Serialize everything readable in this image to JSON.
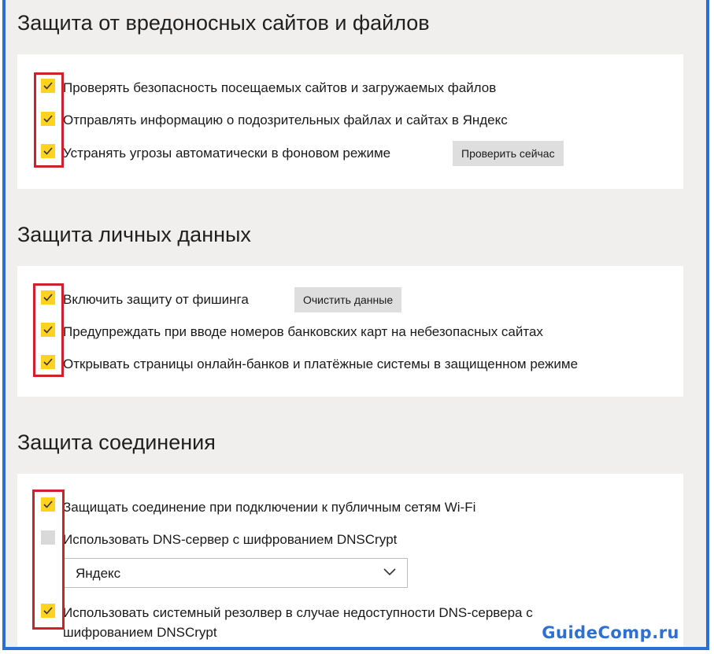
{
  "sections": [
    {
      "title": "Защита от вредоносных сайтов и файлов",
      "items": [
        {
          "label": "Проверять безопасность посещаемых сайтов и загружаемых файлов",
          "checked": true
        },
        {
          "label": "Отправлять информацию о подозрительных файлах и сайтах в Яндекс",
          "checked": true
        },
        {
          "label": "Устранять угрозы автоматически в фоновом режиме",
          "checked": true
        }
      ],
      "button_label": "Проверить сейчас"
    },
    {
      "title": "Защита личных данных",
      "items": [
        {
          "label": "Включить защиту от фишинга",
          "checked": true
        },
        {
          "label": "Предупреждать при вводе номеров банковских карт на небезопасных сайтах",
          "checked": true
        },
        {
          "label": "Открывать страницы онлайн-банков и платёжные системы в защищенном режиме",
          "checked": true
        }
      ],
      "button_label": "Очистить данные"
    },
    {
      "title": "Защита соединения",
      "items": [
        {
          "label": "Защищать соединение при подключении к публичным сетям Wi-Fi",
          "checked": true
        },
        {
          "label": "Использовать DNS-сервер с шифрованием DNSCrypt",
          "checked": false
        },
        {
          "label_line1": "Использовать системный резолвер в случае недоступности DNS-сервера с",
          "label_line2": "шифрованием DNSCrypt",
          "checked": true
        }
      ],
      "dns_select": {
        "value": "Яндекс"
      }
    }
  ],
  "watermark": "GuideComp.ru",
  "colors": {
    "checkbox_on": "#ffd21f",
    "checkbox_off": "#d9d9d9",
    "highlight": "#d0202a",
    "frame": "#2a6fd6"
  },
  "icons": {
    "checkbox_mark": "checkmark-icon",
    "dropdown": "chevron-down-icon"
  }
}
